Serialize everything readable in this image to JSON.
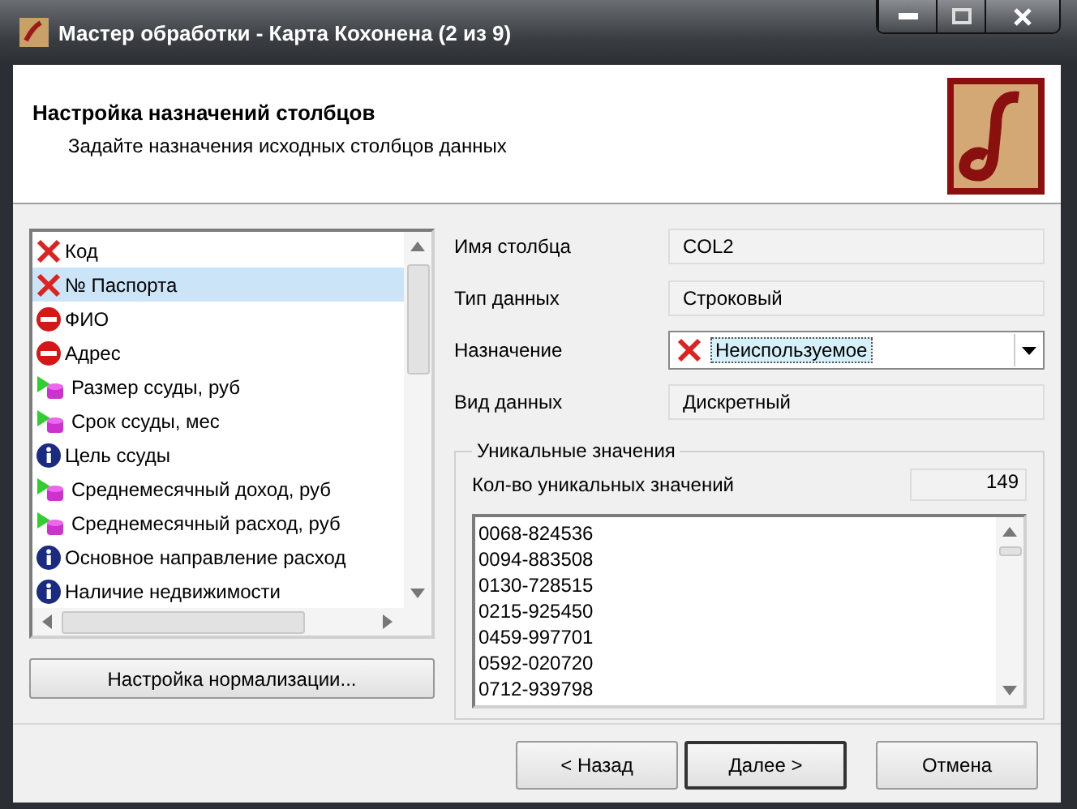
{
  "window": {
    "title": "Мастер обработки - Карта Кохонена (2 из 9)"
  },
  "header": {
    "title": "Настройка назначений столбцов",
    "subtitle": "Задайте назначения исходных столбцов данных"
  },
  "columns": [
    {
      "label": "Код",
      "kind": "unused",
      "selected": false
    },
    {
      "label": "№ Паспорта",
      "kind": "unused",
      "selected": true
    },
    {
      "label": "ФИО",
      "kind": "excluded",
      "selected": false
    },
    {
      "label": "Адрес",
      "kind": "excluded",
      "selected": false
    },
    {
      "label": "Размер ссуды, руб",
      "kind": "input",
      "selected": false
    },
    {
      "label": "Срок ссуды, мес",
      "kind": "input",
      "selected": false
    },
    {
      "label": "Цель ссуды",
      "kind": "info",
      "selected": false
    },
    {
      "label": "Среднемесячный доход, руб",
      "kind": "input",
      "selected": false
    },
    {
      "label": "Среднемесячный расход, руб",
      "kind": "input",
      "selected": false
    },
    {
      "label": "Основное направление расход",
      "kind": "info",
      "selected": false
    },
    {
      "label": "Наличие недвижимости",
      "kind": "info",
      "selected": false
    }
  ],
  "normalize_button": "Настройка нормализации...",
  "properties": [
    {
      "label": "Имя столбца",
      "value": "COL2",
      "kind": "text"
    },
    {
      "label": "Тип данных",
      "value": "Строковый",
      "kind": "text"
    },
    {
      "label": "Назначение",
      "kind": "combo",
      "selection": {
        "text": "Неиспользуемое",
        "kind": "unused"
      }
    },
    {
      "label": "Вид данных",
      "value": "Дискретный",
      "kind": "text"
    }
  ],
  "unique": {
    "title": "Уникальные значения",
    "count_label": "Кол-во уникальных значений",
    "count": "149",
    "values": [
      "0068-824536",
      "0094-883508",
      "0130-728515",
      "0215-925450",
      "0459-997701",
      "0592-020720",
      "0712-939798"
    ]
  },
  "buttons": [
    {
      "label": "< Назад",
      "default": false
    },
    {
      "label": "Далее >",
      "default": true
    },
    {
      "label": "Отмена",
      "default": false
    }
  ]
}
